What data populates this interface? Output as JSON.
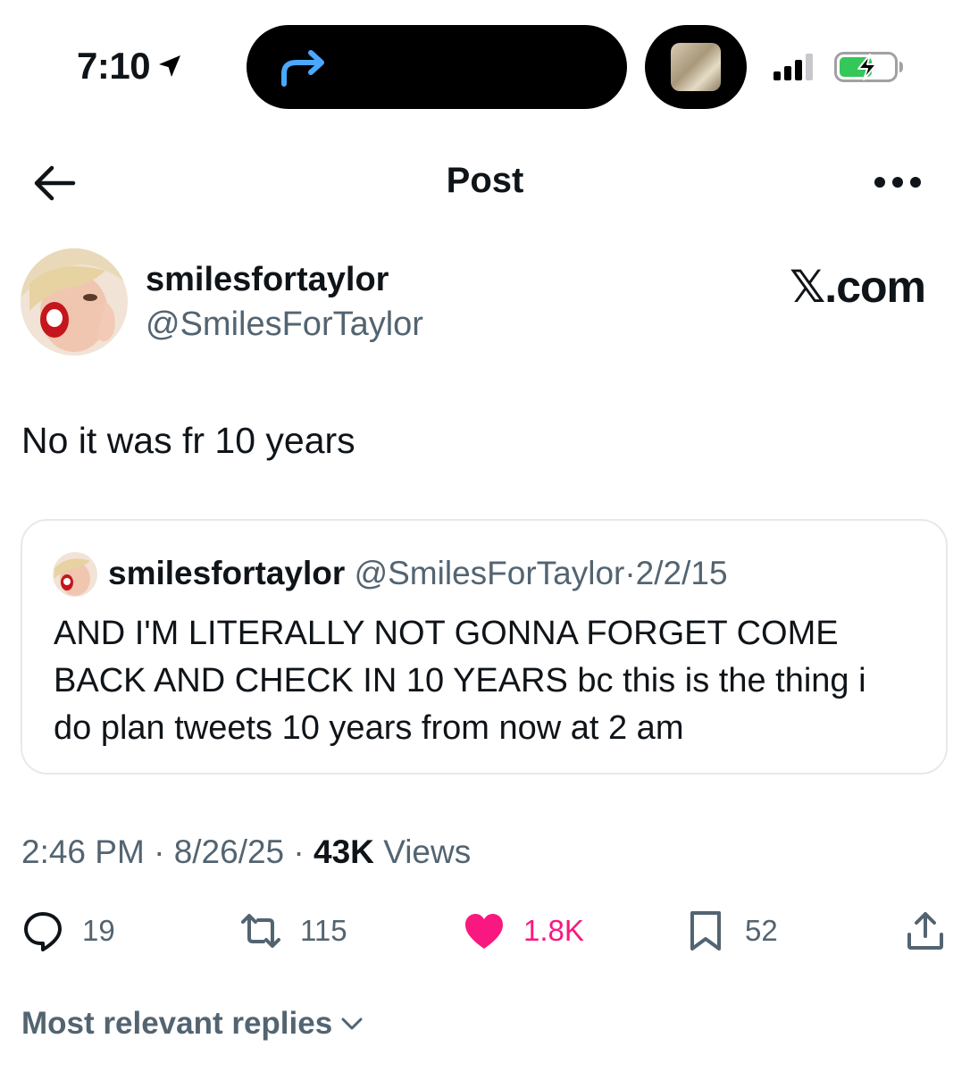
{
  "status_bar": {
    "time": "7:10",
    "location_icon": "location-arrow-icon",
    "island_icon": "forward-arrow-icon",
    "battery_icon": "battery-charging-icon",
    "signal_icon": "cellular-signal-icon"
  },
  "header": {
    "title": "Post",
    "back_icon": "back-arrow-icon",
    "more_icon": "more-horizontal-icon"
  },
  "author": {
    "display_name": "smilesfortaylor",
    "handle": "@SmilesForTaylor"
  },
  "watermark": {
    "x_mark": "𝕏",
    "suffix": ".com"
  },
  "post": {
    "text": "No it was fr 10 years"
  },
  "quote": {
    "display_name": "smilesfortaylor",
    "handle": "@SmilesForTaylor",
    "separator": "·",
    "date": "2/2/15",
    "text": "AND I'M LITERALLY NOT GONNA FORGET COME BACK AND CHECK IN 10 YEARS bc this is the thing i do plan tweets 10 years from now at 2 am"
  },
  "meta": {
    "time": "2:46 PM",
    "sep1": "·",
    "date": "8/26/25",
    "sep2": "·",
    "views_count": "43K",
    "views_label": "Views"
  },
  "actions": {
    "replies": "19",
    "reposts": "115",
    "likes": "1.8K",
    "bookmarks": "52",
    "like_color": "#f91880",
    "muted_color": "#536471"
  },
  "replies_sort": {
    "label": "Most relevant replies"
  }
}
